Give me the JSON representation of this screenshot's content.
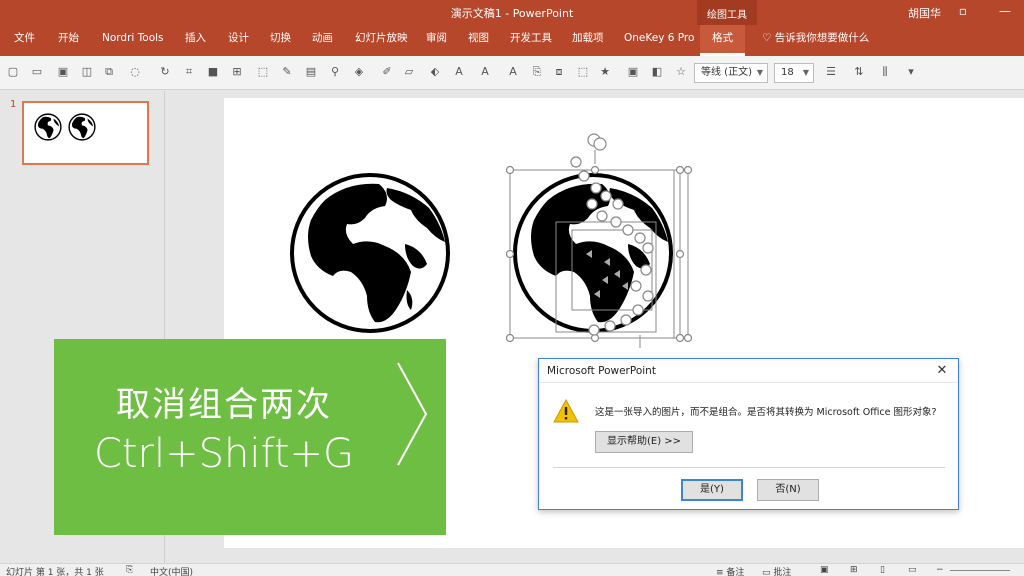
{
  "window": {
    "title": "演示文稿1 - PowerPoint",
    "context_tab_group": "绘图工具",
    "user": "胡国华",
    "restore_icon": "restore-icon",
    "accent": "#b7472a"
  },
  "ribbon": {
    "tabs": [
      "文件",
      "开始",
      "Nordri Tools",
      "插入",
      "设计",
      "切换",
      "动画",
      "幻灯片放映",
      "审阅",
      "视图",
      "开发工具",
      "加载项",
      "OneKey 6 Pro",
      "格式"
    ],
    "active_tab": "格式",
    "tell_me": "告诉我你想要做什么"
  },
  "toolbar": {
    "font_name": "等线 (正文)",
    "font_size": "18"
  },
  "thumbnails": {
    "slide_number": "1"
  },
  "slide": {
    "banner_line1": "取消组合两次",
    "banner_line2": "Ctrl+Shift+G",
    "banner_color": "#6fbe44"
  },
  "dialog": {
    "title": "Microsoft PowerPoint",
    "message": "这是一张导入的图片，而不是组合。是否将其转换为 Microsoft Office 图形对象?",
    "help_button": "显示帮助(E) >>",
    "yes_button": "是(Y)",
    "no_button": "否(N)",
    "icon": "warning-icon"
  },
  "statusbar": {
    "slide_info": "幻灯片 第 1 张，共 1 张",
    "language": "中文(中国)",
    "notes": "备注",
    "comments": "批注"
  }
}
